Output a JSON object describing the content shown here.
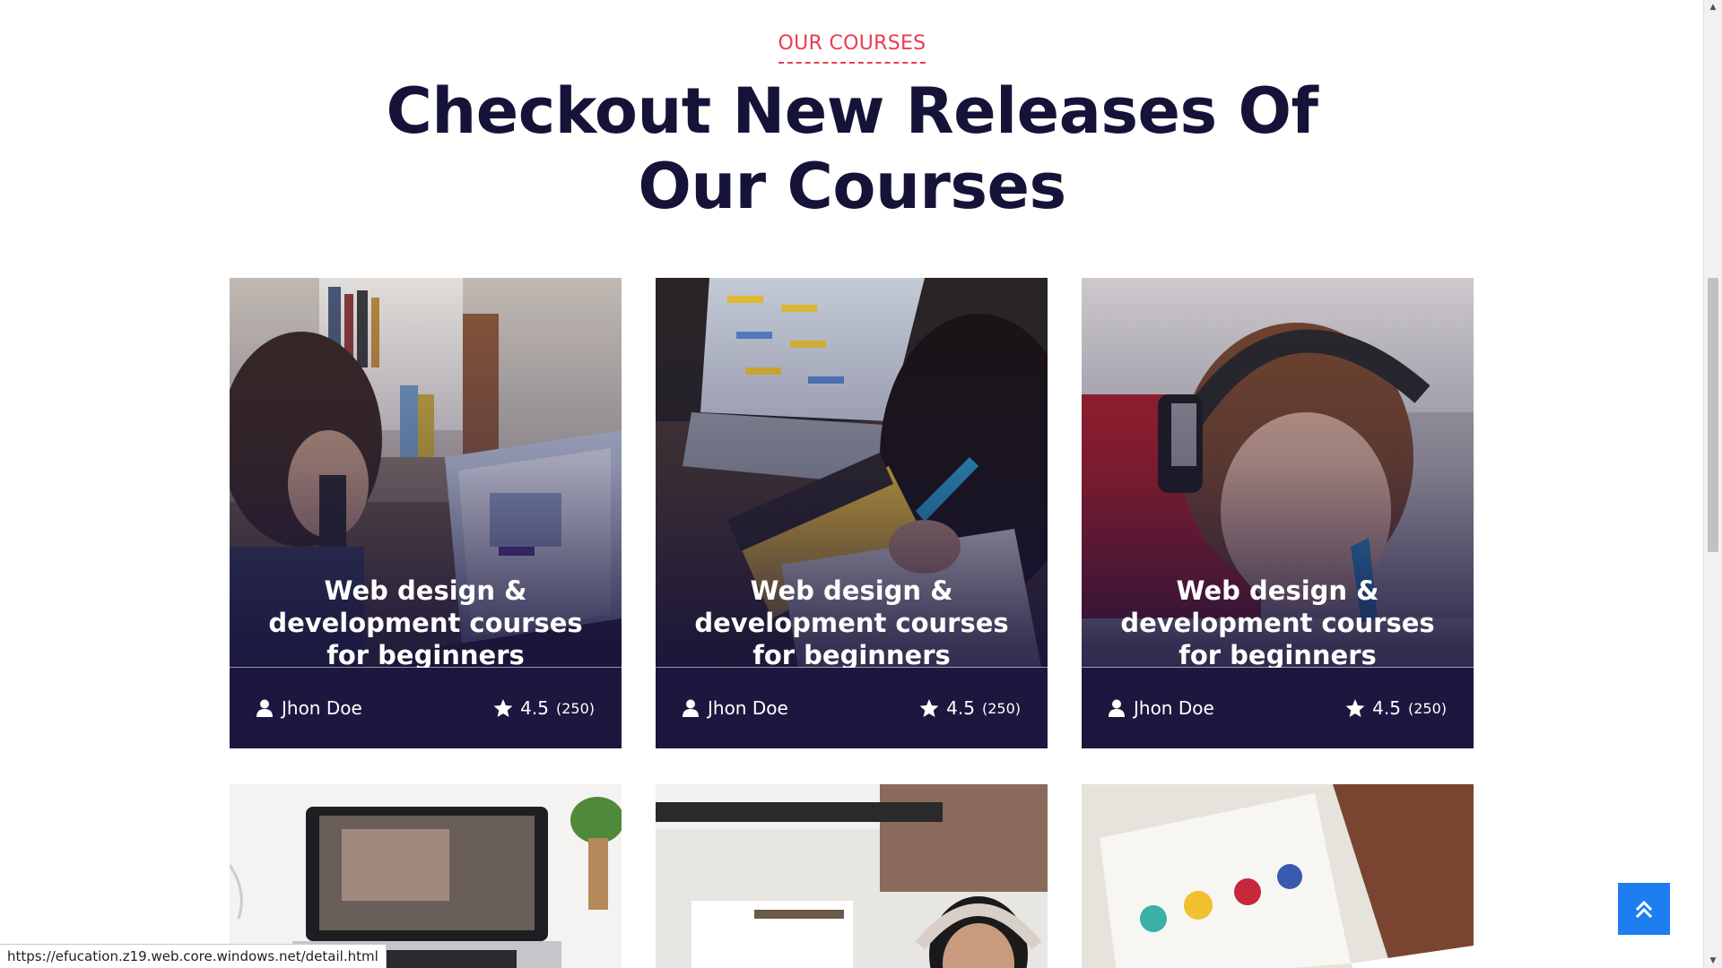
{
  "section": {
    "eyebrow": "OUR COURSES",
    "heading_line1": "Checkout New Releases Of",
    "heading_line2": "Our Courses"
  },
  "courses": [
    {
      "title": "Web design & development courses for beginners",
      "author": "Jhon Doe",
      "rating": "4.5",
      "reviews": "(250)",
      "photo": "girl-with-laptop"
    },
    {
      "title": "Web design & development courses for beginners",
      "author": "Jhon Doe",
      "rating": "4.5",
      "reviews": "(250)",
      "photo": "student-writing-mometrix"
    },
    {
      "title": "Web design & development courses for beginners",
      "author": "Jhon Doe",
      "rating": "4.5",
      "reviews": "(250)",
      "photo": "boy-with-headphones"
    },
    {
      "photo": "laptop-on-desk"
    },
    {
      "photo": "student-in-room"
    },
    {
      "photo": "laptop-web-design"
    }
  ],
  "status_bar": {
    "url": "https://efucation.z19.web.core.windows.net/detail.html"
  },
  "icons": {
    "author": "user-icon",
    "rating": "star-icon",
    "back_to_top": "double-chevron-up-icon"
  },
  "colors": {
    "accent": "#ea3c53",
    "heading": "#161339",
    "card_footer": "#1c173f",
    "back_to_top": "#1e7ef0"
  }
}
